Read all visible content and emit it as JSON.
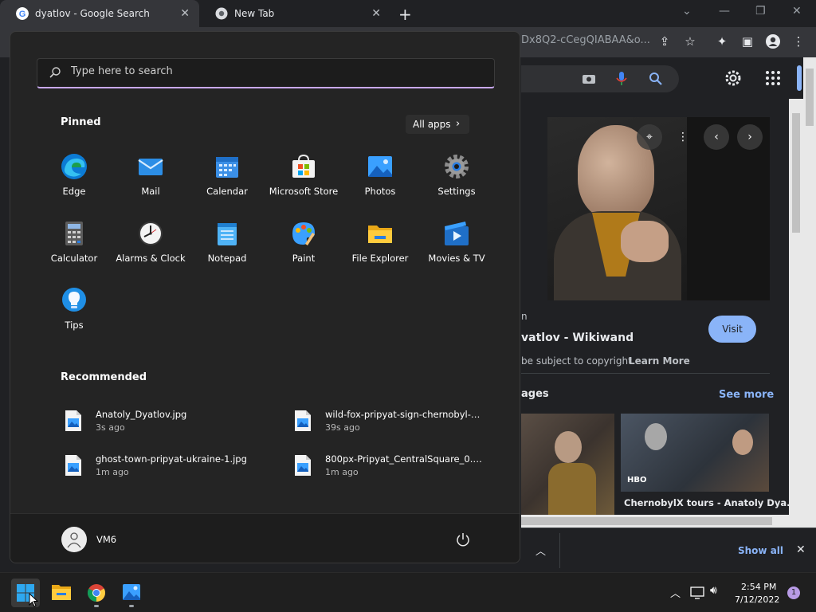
{
  "browser": {
    "tabs": [
      {
        "title": "dyatlov - Google Search"
      },
      {
        "title": "New Tab"
      }
    ],
    "url_visible": "Dx8Q2-cCegQIABAA&o...",
    "panel": {
      "source_suffix": "n",
      "title_fragment": "vatlov - Wikiwand",
      "visit_label": "Visit",
      "copyright_text": "be subject to copyright.",
      "learn_more": "Learn More",
      "related_heading": "ages",
      "see_more": "See more",
      "thumb_badge": "HBO",
      "thumb_caption": "ChernobylX tours - Anatoly Dya..."
    },
    "downloads": {
      "show_all": "Show all"
    }
  },
  "start_menu": {
    "search_placeholder": "Type here to search",
    "pinned_heading": "Pinned",
    "all_apps_label": "All apps",
    "apps": [
      {
        "label": "Edge",
        "icon": "edge-icon"
      },
      {
        "label": "Mail",
        "icon": "mail-icon"
      },
      {
        "label": "Calendar",
        "icon": "calendar-icon"
      },
      {
        "label": "Microsoft Store",
        "icon": "store-icon"
      },
      {
        "label": "Photos",
        "icon": "photos-icon"
      },
      {
        "label": "Settings",
        "icon": "gear-icon"
      },
      {
        "label": "Calculator",
        "icon": "calculator-icon"
      },
      {
        "label": "Alarms & Clock",
        "icon": "clock-icon"
      },
      {
        "label": "Notepad",
        "icon": "notepad-icon"
      },
      {
        "label": "Paint",
        "icon": "paint-icon"
      },
      {
        "label": "File Explorer",
        "icon": "folder-icon"
      },
      {
        "label": "Movies & TV",
        "icon": "movies-icon"
      },
      {
        "label": "Tips",
        "icon": "lightbulb-icon"
      }
    ],
    "recommended_heading": "Recommended",
    "recommended": [
      {
        "name": "Anatoly_Dyatlov.jpg",
        "time": "3s ago"
      },
      {
        "name": "wild-fox-pripyat-sign-chernobyl-3-...",
        "time": "39s ago"
      },
      {
        "name": "ghost-town-pripyat-ukraine-1.jpg",
        "time": "1m ago"
      },
      {
        "name": "800px-Pripyat_CentralSquare_0.jpg",
        "time": "1m ago"
      }
    ],
    "user_name": "VM6"
  },
  "taskbar": {
    "time": "2:54 PM",
    "date": "7/12/2022",
    "notification_count": "1"
  },
  "colors": {
    "accent_purple": "#c8a8f0",
    "google_blue": "#8ab4f8",
    "start_bg": "#242424",
    "taskbar_bg": "#1f1f1f"
  }
}
